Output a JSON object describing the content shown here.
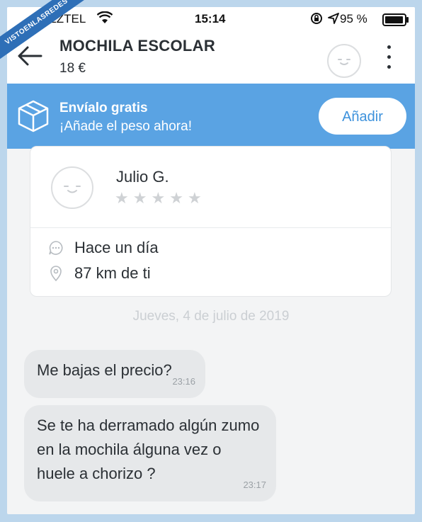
{
  "status_bar": {
    "carrier": "AZZTEL",
    "time": "15:14",
    "battery_pct": "95 %",
    "battery_level": 0.95
  },
  "watermark": "VISTOENLASREDES",
  "header": {
    "title": "MOCHILA ESCOLAR",
    "price": "18 €"
  },
  "banner": {
    "title": "Envíalo gratis",
    "subtitle": "¡Añade el peso ahora!",
    "button_label": "Añadir",
    "color": "#5aa3e3"
  },
  "seller": {
    "name": "Julio G.",
    "rating_stars": 0,
    "last_seen": "Hace un día",
    "distance": "87 km de ti"
  },
  "chat": {
    "date_separator": "Jueves, 4 de julio de 2019",
    "messages": [
      {
        "text": "Me bajas el precio?",
        "time": "23:16"
      },
      {
        "text": "Se te ha derramado algún zumo en la mochila álguna vez o huele a chorizo ?",
        "time": "23:17"
      }
    ]
  }
}
